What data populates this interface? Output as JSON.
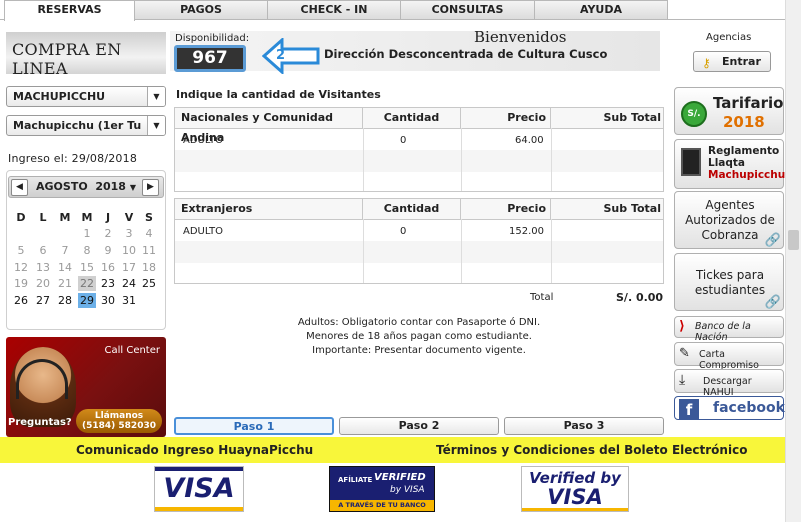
{
  "tabs": [
    "RESERVAS",
    "PAGOS",
    "CHECK - IN",
    "CONSULTAS",
    "AYUDA"
  ],
  "left": {
    "compra": "COMPRA EN LINEA",
    "select1": "MACHUPICCHU",
    "select2": "Machupicchu (1er Tu",
    "ingreso": "Ingreso el:  29/08/2018",
    "month": "AGOSTO",
    "year": "2018",
    "dow": [
      "D",
      "L",
      "M",
      "M",
      "J",
      "V",
      "S"
    ],
    "weeks": [
      [
        "",
        "",
        "",
        "1",
        "2",
        "3",
        "4"
      ],
      [
        "5",
        "6",
        "7",
        "8",
        "9",
        "10",
        "11"
      ],
      [
        "12",
        "13",
        "14",
        "15",
        "16",
        "17",
        "18"
      ],
      [
        "19",
        "20",
        "21",
        "22",
        "23",
        "24",
        "25"
      ],
      [
        "26",
        "27",
        "28",
        "29",
        "30",
        "31",
        ""
      ]
    ],
    "callcenter": "Call Center",
    "preguntas": "Preguntas?",
    "llamanos": "Llámanos",
    "phone": "(5184) 582030"
  },
  "disp": {
    "label": "Disponibilidad:",
    "value": "967",
    "arrow_num": "2",
    "bienvenidos": "Bienvenidos",
    "direccion": "Dirección Desconcentrada de Cultura Cusco"
  },
  "indique": "Indique la cantidad de Visitantes",
  "table1": {
    "headers": [
      "Nacionales y Comunidad Andina",
      "Cantidad",
      "Precio",
      "Sub Total"
    ],
    "row": [
      "ADULTO",
      "0",
      "64.00",
      ""
    ]
  },
  "table2": {
    "headers": [
      "Extranjeros",
      "Cantidad",
      "Precio",
      "Sub Total"
    ],
    "row": [
      "ADULTO",
      "0",
      "152.00",
      ""
    ]
  },
  "total": {
    "label": "Total",
    "value": "S/. 0.00"
  },
  "notes": [
    "Adultos: Obligatorio contar con Pasaporte ó DNI.",
    "Menores de 18 años pagan como estudiante.",
    "Importante: Presentar documento vigente."
  ],
  "pasos": [
    "Paso 1",
    "Paso 2",
    "Paso 3"
  ],
  "right": {
    "agencias": "Agencias",
    "entrar": "Entrar",
    "tarifario": "Tarifario",
    "tarifario_year": "2018",
    "soles": "S/.",
    "reglamento": [
      "Reglamento",
      "Llaqta"
    ],
    "reglamento_red": "Machupicchu",
    "agentes": [
      "Agentes",
      "Autorizados de",
      "Cobranza"
    ],
    "tickes": [
      "Tickes para",
      "estudiantes"
    ],
    "banco": "Banco de la Nación",
    "carta": "Carta Compromiso",
    "nahui": "Descargar NAHUI",
    "facebook": "facebook."
  },
  "footer": {
    "left": "Comunicado Ingreso HuaynaPicchu",
    "right": "Términos y Condiciones del Boleto Electrónico"
  },
  "logos": {
    "visa": "VISA",
    "afiliate": "AFÍLIATE",
    "verified": "VERIFIED",
    "byvisa": "by VISA",
    "atraves": "A TRAVÉS DE TU BANCO",
    "verified2": "Verified by",
    "visa2": "VISA"
  },
  "colors": {
    "visa_blue": "#1a1f71",
    "visa_gold": "#f7b600",
    "yellow": "#f8f63a",
    "fb": "#3b5998",
    "sel": "#6cb0e8"
  }
}
